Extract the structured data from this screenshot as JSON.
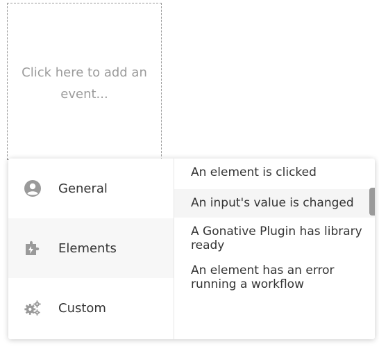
{
  "placeholder": {
    "text": "Click here to add an event..."
  },
  "menu": {
    "categories": [
      {
        "label": "General",
        "icon": "user-circle-icon"
      },
      {
        "label": "Elements",
        "icon": "puzzle-bolt-icon"
      },
      {
        "label": "Custom",
        "icon": "gears-icon"
      }
    ],
    "active_category": "Elements",
    "events": [
      {
        "label": "An element is clicked"
      },
      {
        "label": "An input's value is changed"
      },
      {
        "label": "A Gonative Plugin has library ready"
      },
      {
        "label": "An element has an error running a workflow"
      }
    ]
  },
  "colors": {
    "icon": "#9a9a9a",
    "text": "#333333",
    "placeholder_text": "#9b9b9b",
    "active_bg": "#f7f7f7"
  }
}
